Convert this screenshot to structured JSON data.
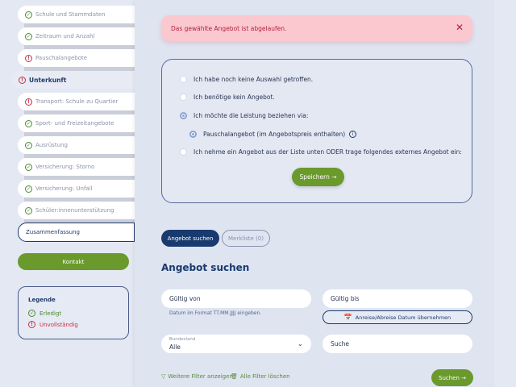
{
  "sidebar": {
    "steps": [
      {
        "label": "Schule und Stammdaten",
        "status": "ok"
      },
      {
        "label": "Zeitraum und Anzahl",
        "status": "ok"
      },
      {
        "label": "Pauschalangebote",
        "status": "warn"
      },
      {
        "label": "Unterkunft",
        "status": "warn"
      },
      {
        "label": "Transport: Schule zu Quartier",
        "status": "warn"
      },
      {
        "label": "Sport- und Freizeitangebote",
        "status": "ok"
      },
      {
        "label": "Ausrüstung",
        "status": "ok"
      },
      {
        "label": "Versicherung: Storno",
        "status": "ok"
      },
      {
        "label": "Versicherung: Unfall",
        "status": "ok"
      },
      {
        "label": "Schüler:innenunterstützung",
        "status": "ok"
      },
      {
        "label": "Zusammenfassung",
        "status": "none"
      }
    ],
    "contact_label": "Kontakt",
    "legend": {
      "title": "Legende",
      "done": "Erledigt",
      "incomplete": "Unvollständig"
    }
  },
  "alert": {
    "message": "Das gewählte Angebot ist abgelaufen."
  },
  "options": {
    "opt1": "Ich habe noch keine Auswahl getroffen.",
    "opt2": "Ich benötige kein Angebot.",
    "opt3": "Ich möchte die Leistung beziehen via:",
    "opt3_sub": "Pauschalangebot (im Angebotspreis enthalten)",
    "opt4": "Ich nehme ein Angebot aus der Liste unten ODER trage folgendes externes Angebot ein:",
    "save_label": "Speichern →"
  },
  "tabs": {
    "search": "Angebot suchen",
    "watchlist": "Merkliste (0)"
  },
  "search": {
    "title": "Angebot suchen",
    "valid_from": "Gültig von",
    "valid_to": "Gültig bis",
    "date_hint": "Datum im Format TT.MM.JJJJ eingeben.",
    "apply_dates": "Anreise/Abreise Datum übernehmen",
    "state_label": "Bundesland",
    "state_value": "Alle",
    "search_placeholder": "Suche",
    "more_filters": "Weitere Filter anzeigen",
    "clear_filters": "Alle Filter löschen",
    "search_button": "Suchen →"
  },
  "colors": {
    "accent_green": "#6a9a2c",
    "navy": "#183a6e",
    "alert_bg": "#fbc8d0",
    "alert_text": "#b0233c"
  }
}
